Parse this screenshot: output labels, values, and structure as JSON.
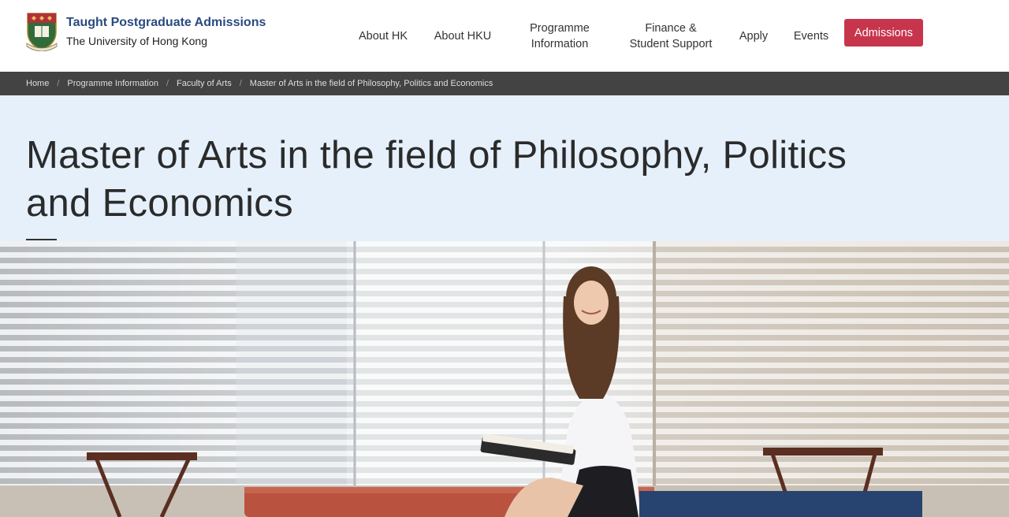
{
  "brand": {
    "title": "Taught Postgraduate Admissions",
    "subtitle": "The University of Hong Kong",
    "logo_icon": "hku-crest-icon"
  },
  "nav": {
    "items": [
      {
        "label": "About HK"
      },
      {
        "label": "About HKU"
      },
      {
        "label": "Programme\nInformation"
      },
      {
        "label": "Finance &\nStudent Support"
      },
      {
        "label": "Apply"
      },
      {
        "label": "Events"
      }
    ],
    "cta": "Admissions"
  },
  "breadcrumb": {
    "items": [
      "Home",
      "Programme Information",
      "Faculty of Arts",
      "Master of Arts in the field of Philosophy, Politics and Economics"
    ],
    "separator": "/"
  },
  "page": {
    "title": "Master of Arts in the field of Philosophy, Politics and Economics"
  },
  "colors": {
    "brand_blue": "#2a4a80",
    "cta_red": "#c7354c",
    "breadcrumb_bg": "#434343",
    "hero_bg": "#e5f0fb",
    "panel_navy": "#26446f"
  }
}
